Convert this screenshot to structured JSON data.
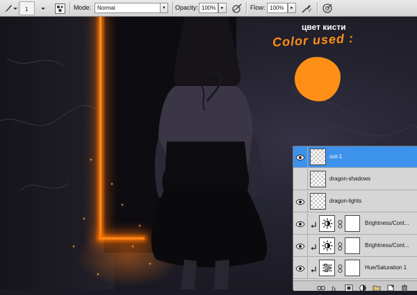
{
  "options_bar": {
    "brush_size": "1",
    "mode_label": "Mode:",
    "mode_value": "Normal",
    "opacity_label": "Opacity:",
    "opacity_value": "100%",
    "flow_label": "Flow:",
    "flow_value": "100%",
    "icons": [
      "brush-tool-icon",
      "brush-panel-toggle-icon",
      "pressure-opacity-icon",
      "pressure-size-icon",
      "airbrush-icon"
    ]
  },
  "annotations": {
    "label_ru": "цвет кисти",
    "label_en": "Color used :",
    "swatch_color": "#ff8f16"
  },
  "layers": [
    {
      "name": "out-1",
      "kind": "pixel",
      "selected": true,
      "visible": true
    },
    {
      "name": "dragon-shadows",
      "kind": "pixel",
      "selected": false,
      "visible": false
    },
    {
      "name": "dragon-lights",
      "kind": "pixel",
      "selected": false,
      "visible": true
    },
    {
      "name": "Brightness/Cont...",
      "kind": "brightness-contrast",
      "selected": false,
      "visible": true,
      "clipped": true
    },
    {
      "name": "Brightness/Cont...",
      "kind": "brightness-contrast",
      "selected": false,
      "visible": true,
      "clipped": true
    },
    {
      "name": "Hue/Saturation 1",
      "kind": "hue-saturation",
      "selected": false,
      "visible": true,
      "clipped": true
    }
  ],
  "layer_footer_icons": [
    "link-layers-icon",
    "fx-icon",
    "add-mask-icon",
    "new-adjustment-icon",
    "new-group-icon",
    "new-layer-icon",
    "delete-layer-icon"
  ],
  "colors": {
    "accent_selected": "#3d92eb",
    "glow": "#ff8a1a"
  }
}
